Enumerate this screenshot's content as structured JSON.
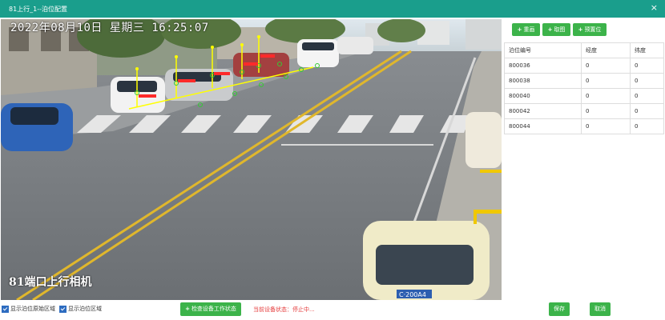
{
  "window": {
    "title": "81上行_1--泊位配置",
    "close_glyph": "×"
  },
  "camera": {
    "timestamp": "2022年08月10日  星期三  16:25:07",
    "name": "81端口上行相机",
    "plate_text": "C·200A4",
    "overlay_colors": {
      "line": "#ffff00",
      "marker": "#33cc33",
      "label": "#ff2a2a"
    }
  },
  "toolbar": {
    "redraw": {
      "icon": "plus-icon",
      "label": "重画"
    },
    "capture": {
      "icon": "plus-icon",
      "label": "取图"
    },
    "preset": {
      "icon": "plus-icon",
      "label": "预置位"
    }
  },
  "berth_table": {
    "headers": [
      "泊位编号",
      "经度",
      "纬度"
    ],
    "rows": [
      [
        "800036",
        "0",
        "0"
      ],
      [
        "800038",
        "0",
        "0"
      ],
      [
        "800040",
        "0",
        "0"
      ],
      [
        "800042",
        "0",
        "0"
      ],
      [
        "800044",
        "0",
        "0"
      ]
    ]
  },
  "footer": {
    "show_raw_region": "显示泊位原始区域",
    "show_region": "显示泊位区域",
    "check_status_button": "检查设备工作状态",
    "device_status": "当前设备状态：停止中...",
    "save": "保存",
    "cancel": "取消"
  },
  "colors": {
    "header_bg": "#1a9e8c",
    "button_green": "#3cb34a",
    "status_red": "#e53b3b",
    "checkbox_blue": "#2d6cc0"
  }
}
